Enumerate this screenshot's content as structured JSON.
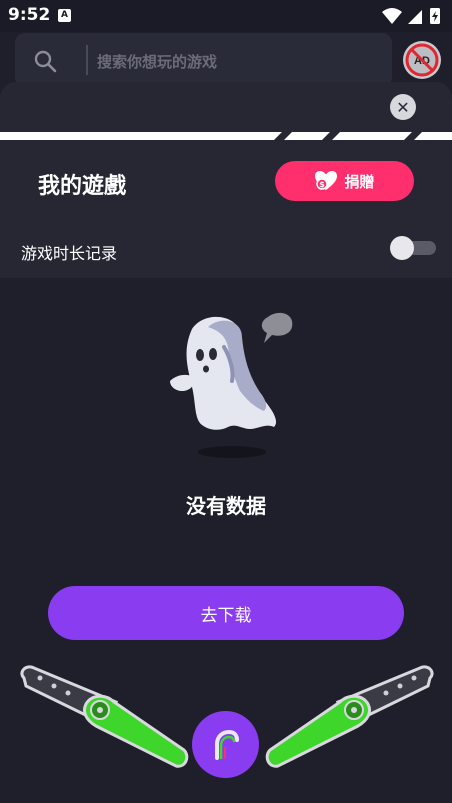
{
  "status_bar": {
    "time": "9:52",
    "notification_icon": "a-icon",
    "icons": [
      "wifi-icon",
      "signal-icon",
      "battery-icon"
    ]
  },
  "search": {
    "placeholder": "搜索你想玩的游戏",
    "icon": "search-icon"
  },
  "ad_button": {
    "icon": "ad-block-icon",
    "label": "AD"
  },
  "panel": {
    "close_icon": "close-icon",
    "title": "我的遊戲",
    "donate": {
      "label": "捐贈",
      "icon": "heart-money-icon",
      "color": "#ff2f6d"
    },
    "playtime": {
      "label": "游戏时长记录",
      "enabled": false
    },
    "empty_state": {
      "illustration": "ghost-icon",
      "text": "没有数据"
    },
    "download_button": {
      "label": "去下载",
      "color": "#8a3cf0"
    },
    "pinball": {
      "left_flipper": "left-flipper-icon",
      "right_flipper": "right-flipper-icon",
      "center_button_icon": "pinball-logo-icon"
    }
  },
  "colors": {
    "background": "#1e1f2b",
    "panel_header": "#262733",
    "accent_purple": "#8a3cf0",
    "accent_pink": "#ff2f6d",
    "flipper_green": "#3ed62a"
  }
}
